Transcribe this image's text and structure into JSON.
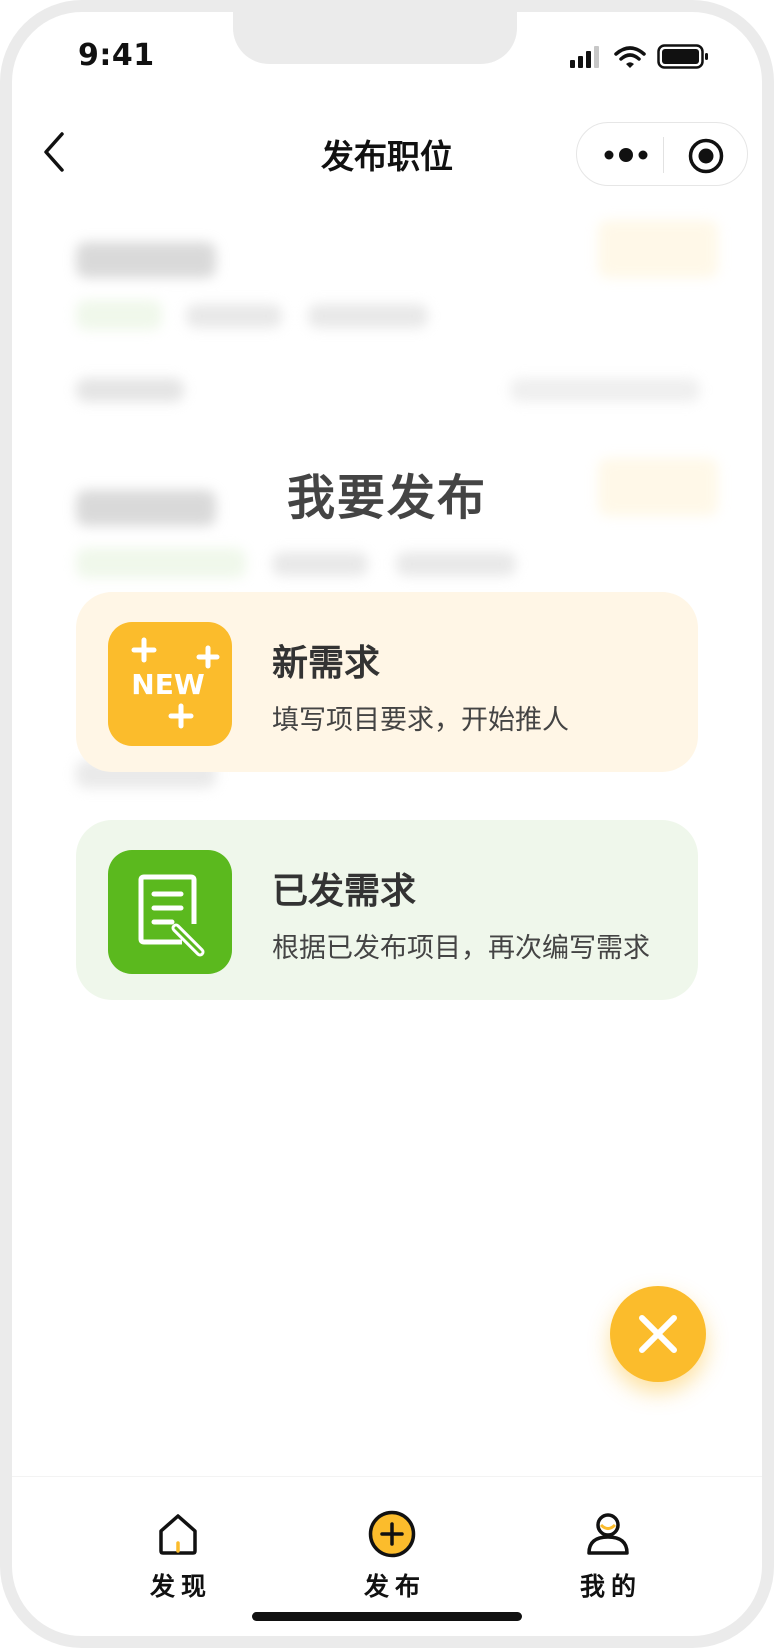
{
  "status_bar": {
    "time": "9:41"
  },
  "nav": {
    "title": "发布职位"
  },
  "popup": {
    "title": "我要发布",
    "options": [
      {
        "title": "新需求",
        "subtitle": "填写项目要求，开始推人",
        "icon_text": "NEW",
        "icon": "new-sparkle-icon",
        "color": "#fbbc2c"
      },
      {
        "title": "已发需求",
        "subtitle": "根据已发布项目，再次编写需求",
        "icon": "document-edit-icon",
        "color": "#5bb91e"
      }
    ]
  },
  "tabbar": {
    "items": [
      {
        "label": "发现",
        "icon": "home-icon"
      },
      {
        "label": "发布",
        "icon": "plus-circle-icon"
      },
      {
        "label": "我的",
        "icon": "user-icon"
      }
    ]
  },
  "colors": {
    "accent": "#fbbc2c",
    "green": "#5bb91e"
  }
}
